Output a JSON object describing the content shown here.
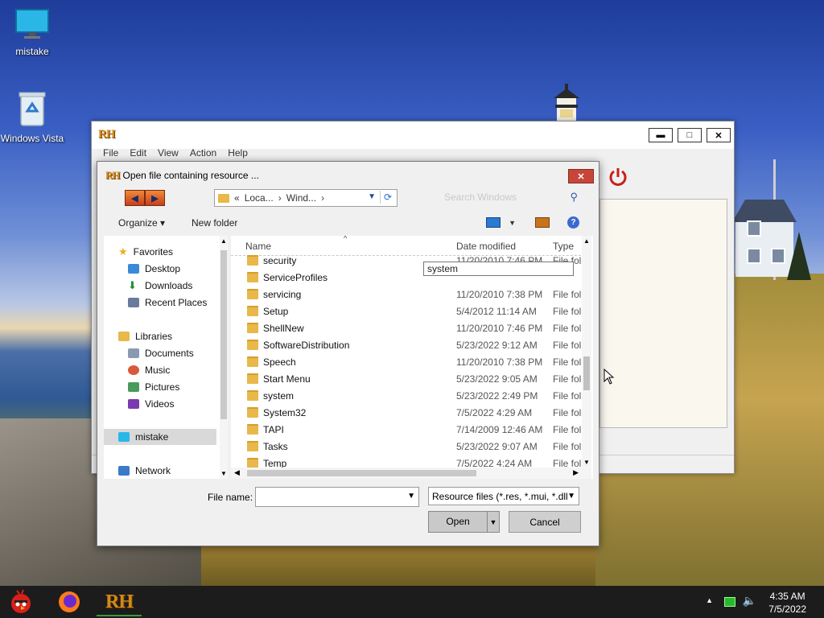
{
  "desktop": {
    "icons": [
      {
        "label": "mistake"
      },
      {
        "label": "Windows Vista"
      }
    ]
  },
  "app_window": {
    "logo": "RH",
    "menu": [
      "File",
      "Edit",
      "View",
      "Action",
      "Help"
    ],
    "controls": {
      "minimize": "▬",
      "maximize": "□",
      "close": "✕"
    }
  },
  "dialog": {
    "title": "Open file containing resource ...",
    "close": "✕",
    "address": {
      "segments": [
        "Loca...",
        "Wind..."
      ],
      "prefix": "«"
    },
    "search_placeholder": "Search Windows",
    "toolbar": {
      "organize": "Organize ▾",
      "new_folder": "New folder"
    },
    "nav": {
      "favorites": {
        "header": "Favorites",
        "items": [
          "Desktop",
          "Downloads",
          "Recent Places"
        ]
      },
      "libraries": {
        "header": "Libraries",
        "items": [
          "Documents",
          "Music",
          "Pictures",
          "Videos"
        ]
      },
      "computer": "mistake",
      "network": "Network"
    },
    "columns": {
      "name": "Name",
      "date": "Date modified",
      "type": "Type"
    },
    "tooltip": "system",
    "files": [
      {
        "name": "security",
        "date": "11/20/2010 7:46 PM",
        "type": "File fol"
      },
      {
        "name": "ServiceProfiles",
        "date": "",
        "type": ""
      },
      {
        "name": "servicing",
        "date": "11/20/2010 7:38 PM",
        "type": "File fol"
      },
      {
        "name": "Setup",
        "date": "5/4/2012 11:14 AM",
        "type": "File fol"
      },
      {
        "name": "ShellNew",
        "date": "11/20/2010 7:46 PM",
        "type": "File fol"
      },
      {
        "name": "SoftwareDistribution",
        "date": "5/23/2022 9:12 AM",
        "type": "File fol"
      },
      {
        "name": "Speech",
        "date": "11/20/2010 7:38 PM",
        "type": "File fol"
      },
      {
        "name": "Start Menu",
        "date": "5/23/2022 9:05 AM",
        "type": "File fol"
      },
      {
        "name": "system",
        "date": "5/23/2022 2:49 PM",
        "type": "File fol"
      },
      {
        "name": "System32",
        "date": "7/5/2022 4:29 AM",
        "type": "File fol"
      },
      {
        "name": "TAPI",
        "date": "7/14/2009 12:46 AM",
        "type": "File fol"
      },
      {
        "name": "Tasks",
        "date": "5/23/2022 9:07 AM",
        "type": "File fol"
      },
      {
        "name": "Temp",
        "date": "7/5/2022 4:24 AM",
        "type": "File fol"
      }
    ],
    "file_name_label": "File name:",
    "file_name_value": "",
    "file_type": "Resource files (*.res, *.mui, *.dll",
    "open": "Open",
    "cancel": "Cancel"
  },
  "taskbar": {
    "clock_time": "4:35 AM",
    "clock_date": "7/5/2022",
    "rh_label": "RH"
  }
}
